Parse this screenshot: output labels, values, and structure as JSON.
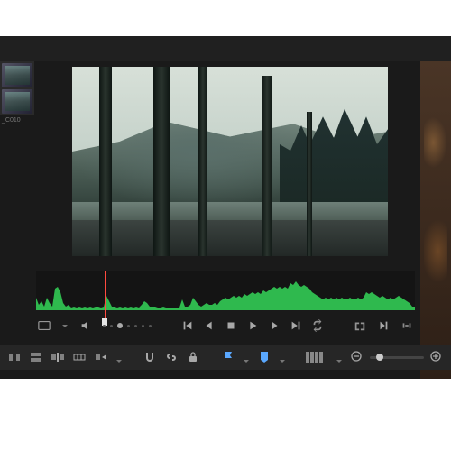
{
  "clip": {
    "label": "_C010"
  },
  "transport": {
    "display_mode": "display-mode",
    "volume": "volume",
    "jog": "jog-slider",
    "first": "go-to-first-frame",
    "prev": "previous-frame",
    "stop": "stop",
    "play": "play",
    "next": "next-frame",
    "last": "go-to-last-frame",
    "loop": "loop",
    "match": "match-frame",
    "in_out": "mark-in-out"
  },
  "toolbar": {
    "selection": "selection-tool",
    "track_select": "track-select-tool",
    "edit_mode": "edit-mode",
    "insert": "insert-mode",
    "dynamic": "dynamic-trim",
    "snap": "snapping",
    "link": "linked-selection",
    "lock": "position-lock",
    "flag": "flag",
    "marker": "marker",
    "view": "view-options",
    "zoom_out": "zoom-out",
    "zoom_in": "zoom-in"
  },
  "colors": {
    "accent": "#5aa8ff",
    "waveform": "#2fb94e",
    "playhead": "#ff4a3f"
  },
  "waveform": {
    "playhead_position_percent": 18
  }
}
